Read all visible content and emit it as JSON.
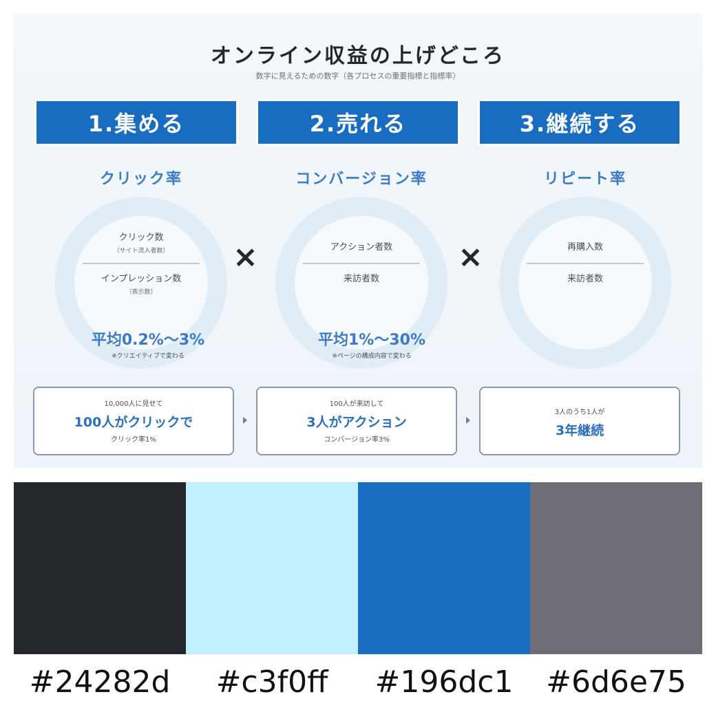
{
  "infographic": {
    "title": "オンライン収益の上げどころ",
    "subtitle": "数字に見えるための数字（各プロセスの重要指標と指標率）",
    "steps": [
      "1.集める",
      "2.売れる",
      "3.継続する"
    ],
    "metrics": [
      {
        "name": "クリック率",
        "numerator": "クリック数",
        "numerator_note": "（サイト流入者数）",
        "denominator": "インプレッション数",
        "denominator_note": "（表示数）"
      },
      {
        "name": "コンバージョン率",
        "numerator": "アクション者数",
        "numerator_note": "",
        "denominator": "来訪者数",
        "denominator_note": ""
      },
      {
        "name": "リピート率",
        "numerator": "再購入数",
        "numerator_note": "",
        "denominator": "来訪者数",
        "denominator_note": ""
      }
    ],
    "operator": "×",
    "averages": [
      {
        "value": "平均0.2%〜3%",
        "note": "※クリエイティブで変わる"
      },
      {
        "value": "平均1%〜30%",
        "note": "※ページの構成内容で変わる"
      }
    ],
    "examples": [
      {
        "line1": "10,000人に見せて",
        "line2": "100人がクリックで",
        "line3": "クリック率1%"
      },
      {
        "line1": "100人が来訪して",
        "line2": "3人がアクション",
        "line3": "コンバージョン率3%"
      },
      {
        "line1": "3人のうち1人が",
        "line2": "3年継続",
        "line3": ""
      }
    ]
  },
  "palette": [
    {
      "hex": "#24282d",
      "label": "#24282d"
    },
    {
      "hex": "#c3f0ff",
      "label": "#c3f0ff"
    },
    {
      "hex": "#196dc1",
      "label": "#196dc1"
    },
    {
      "hex": "#6d6e75",
      "label": "#6d6e75"
    }
  ]
}
